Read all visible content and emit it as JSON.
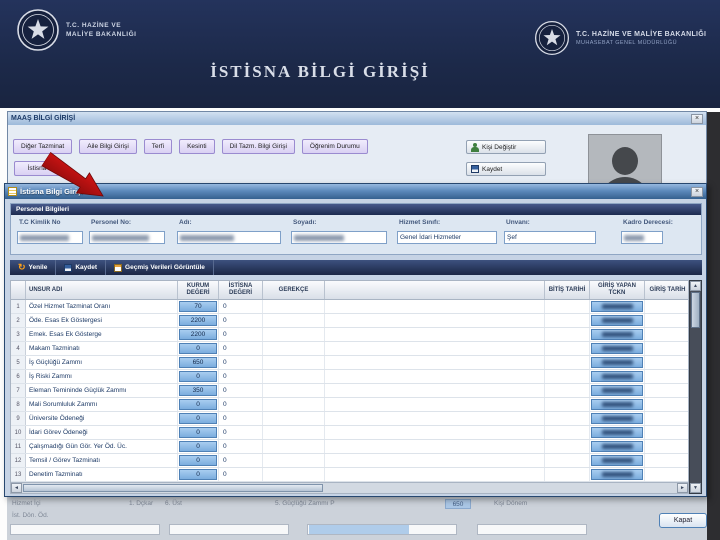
{
  "header": {
    "title": "İSTİSNA BİLGİ GİRİŞİ",
    "left_logo_line1": "T.C. HAZİNE VE",
    "left_logo_line2": "MALİYE BAKANLIĞI",
    "right_logo_line1": "T.C. HAZİNE VE MALİYE BAKANLIĞI",
    "right_logo_line2": "MUHASEBAT GENEL MÜDÜRLÜĞÜ"
  },
  "icons": {
    "close": "×",
    "up": "▲",
    "down": "▼",
    "left": "◄",
    "right": "►",
    "refresh": "↻"
  },
  "maas_window": {
    "title": "MAAŞ BİLGİ GİRİŞİ",
    "toolbar_buttons": [
      "Diğer Tazminat",
      "Aile Bilgi Girişi",
      "Terfi",
      "Kesinti",
      "Dil Tazm. Bilgi Girişi",
      "Öğrenim Durumu"
    ],
    "istisna_button": "İstisna",
    "kisi_degistir_button": "Kişi Değiştir",
    "kaydet_button": "Kaydet"
  },
  "istisna_window": {
    "title": "İstisna Bilgi Girişi",
    "group_title": "Personel Bilgileri",
    "fields": {
      "tc_label": "T.C Kimlik No",
      "tc_value": "",
      "personel_label": "Personel No:",
      "personel_value": "",
      "adi_label": "Adı:",
      "adi_value": "",
      "soyadi_label": "Soyadı:",
      "soyadi_value": "",
      "hizmet_label": "Hizmet Sınıfı:",
      "hizmet_value": "Genel İdari Hizmetler",
      "unvan_label": "Unvanı:",
      "unvan_value": "Şef",
      "kadro_label": "Kadro Derecesi:",
      "kadro_value": ""
    },
    "actions": [
      "Yenile",
      "Kaydet",
      "Geçmiş Verileri Görüntüle"
    ],
    "table": {
      "headers": [
        "",
        "UNSUR ADI",
        "KURUM DEĞERİ",
        "İSTİSNA DEĞERİ",
        "GEREKÇE",
        "",
        "BİTİŞ TARİHİ",
        "GİRİŞ YAPAN TCKN",
        "GİRİŞ TARİH"
      ],
      "rows": [
        {
          "no": "1",
          "unsur": "Özel Hizmet Tazminat Oranı",
          "kurum": "70",
          "istisna": "0"
        },
        {
          "no": "2",
          "unsur": "Öde. Esas Ek Göstergesi",
          "kurum": "2200",
          "istisna": "0"
        },
        {
          "no": "3",
          "unsur": "Emek. Esas Ek Gösterge",
          "kurum": "2200",
          "istisna": "0"
        },
        {
          "no": "4",
          "unsur": "Makam Tazminatı",
          "kurum": "0",
          "istisna": "0"
        },
        {
          "no": "5",
          "unsur": "İş Güçlüğü Zammı",
          "kurum": "650",
          "istisna": "0"
        },
        {
          "no": "6",
          "unsur": "İş Riski Zammı",
          "kurum": "0",
          "istisna": "0"
        },
        {
          "no": "7",
          "unsur": "Eleman Temininde Güçlük Zammı",
          "kurum": "350",
          "istisna": "0"
        },
        {
          "no": "8",
          "unsur": "Mali Sorumluluk Zammı",
          "kurum": "0",
          "istisna": "0"
        },
        {
          "no": "9",
          "unsur": "Üniversite Ödeneği",
          "kurum": "0",
          "istisna": "0"
        },
        {
          "no": "10",
          "unsur": "İdari Görev Ödeneği",
          "kurum": "0",
          "istisna": "0"
        },
        {
          "no": "11",
          "unsur": "Çalışmadığı Gün Gör. Yer Öd. Üc.",
          "kurum": "0",
          "istisna": "0"
        },
        {
          "no": "12",
          "unsur": "Temsil / Görev Tazminatı",
          "kurum": "0",
          "istisna": "0"
        },
        {
          "no": "13",
          "unsur": "Denetim Tazminatı",
          "kurum": "0",
          "istisna": "0"
        }
      ]
    }
  },
  "background": {
    "faint_items": [
      "Hizmet İçi",
      "1. Dçkar",
      "6. Üst",
      "5. Güçlüğü Zammı P",
      "650",
      "Kişi Dönem",
      "İst. Dön. Öd."
    ],
    "kapat_button": "Kapat"
  },
  "colors": {
    "header_bg": "#1c2949",
    "titlebar_blue": "#35618f",
    "cell_blue": "#7cadde",
    "arrow_red": "#b51010"
  }
}
